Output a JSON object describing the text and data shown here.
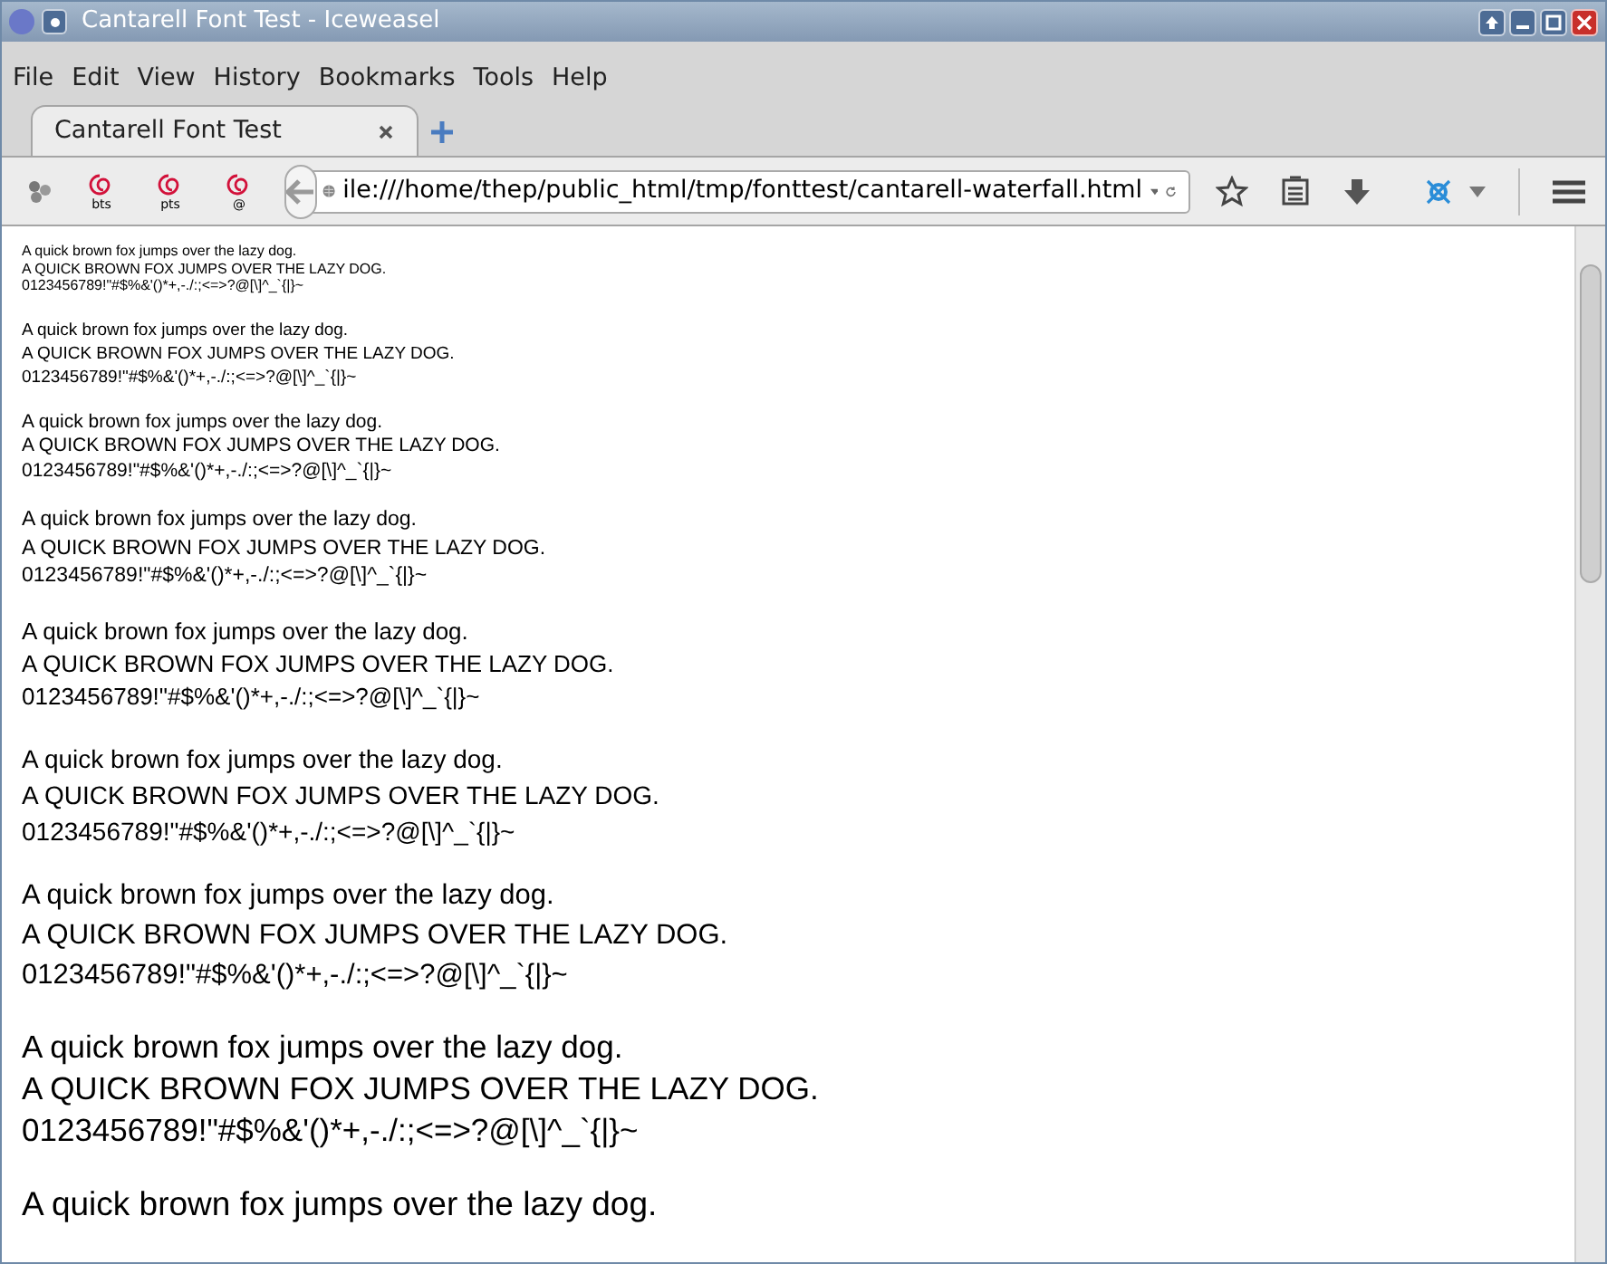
{
  "window": {
    "title": "Cantarell Font Test - Iceweasel"
  },
  "menu": [
    "File",
    "Edit",
    "View",
    "History",
    "Bookmarks",
    "Tools",
    "Help"
  ],
  "tabs": [
    {
      "label": "Cantarell Font Test",
      "selected": true
    }
  ],
  "toolbar_icons": [
    {
      "kind": "gear"
    },
    {
      "kind": "swirl",
      "label": "bts"
    },
    {
      "kind": "swirl",
      "label": "pts"
    },
    {
      "kind": "swirl",
      "label": "@"
    }
  ],
  "url": {
    "value": "ile:///home/thep/public_html/tmp/fonttest/cantarell-waterfall.html"
  },
  "page": {
    "blocks": [
      {
        "lines": [
          "A quick brown fox jumps over the lazy dog.",
          "A QUICK BROWN FOX JUMPS OVER THE LAZY DOG.",
          "0123456789!\"#$%&'()*+,-./:;<=>?@[\\]^_`{|}~"
        ]
      },
      {
        "lines": [
          "A quick brown fox jumps over the lazy dog.",
          "A QUICK BROWN FOX JUMPS OVER THE LAZY DOG.",
          "0123456789!\"#$%&'()*+,-./:;<=>?@[\\]^_`{|}~"
        ]
      },
      {
        "lines": [
          "A quick brown fox jumps over the lazy dog.",
          "A QUICK BROWN FOX JUMPS OVER THE LAZY DOG.",
          "0123456789!\"#$%&'()*+,-./:;<=>?@[\\]^_`{|}~"
        ]
      },
      {
        "lines": [
          "A quick brown fox jumps over the lazy dog.",
          "A QUICK BROWN FOX JUMPS OVER THE LAZY DOG.",
          "0123456789!\"#$%&'()*+,-./:;<=>?@[\\]^_`{|}~"
        ]
      },
      {
        "lines": [
          "A quick brown fox jumps over the lazy dog.",
          "A QUICK BROWN FOX JUMPS OVER THE LAZY DOG.",
          "0123456789!\"#$%&'()*+,-./:;<=>?@[\\]^_`{|}~"
        ]
      },
      {
        "lines": [
          "A quick brown fox jumps over the lazy dog.",
          "A QUICK BROWN FOX JUMPS OVER THE LAZY DOG.",
          "0123456789!\"#$%&'()*+,-./:;<=>?@[\\]^_`{|}~"
        ]
      },
      {
        "lines": [
          "A quick brown fox jumps over the lazy dog.",
          "A QUICK BROWN FOX JUMPS OVER THE LAZY DOG.",
          "0123456789!\"#$%&'()*+,-./:;<=>?@[\\]^_`{|}~"
        ]
      },
      {
        "lines": [
          "A quick brown fox jumps over the lazy dog.",
          "A QUICK BROWN FOX JUMPS OVER THE LAZY DOG.",
          "0123456789!\"#$%&'()*+,-./:;<=>?@[\\]^_`{|}~"
        ]
      },
      {
        "lines": [
          "A quick brown fox jumps over the lazy dog."
        ]
      }
    ]
  }
}
